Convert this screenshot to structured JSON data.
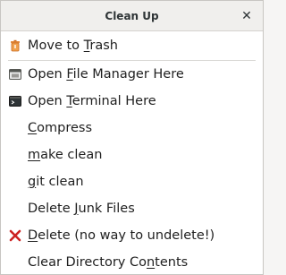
{
  "window": {
    "title": "Clean Up",
    "close_glyph": "✕"
  },
  "menu": {
    "items": [
      {
        "pre": "Move to ",
        "mn": "T",
        "post": "rash",
        "icon": "trash-icon"
      },
      {
        "pre": "Open ",
        "mn": "F",
        "post": "ile Manager Here",
        "icon": "file-manager-icon"
      },
      {
        "pre": "Open ",
        "mn": "T",
        "post": "erminal Here",
        "icon": "terminal-icon"
      },
      {
        "pre": "",
        "mn": "C",
        "post": "ompress"
      },
      {
        "pre": "",
        "mn": "m",
        "post": "ake clean"
      },
      {
        "pre": "",
        "mn": "g",
        "post": "it clean"
      },
      {
        "pre": "Delete ",
        "mn": "J",
        "post": "unk Files"
      },
      {
        "pre": "",
        "mn": "D",
        "post": "elete (no way to undelete!)",
        "icon": "delete-icon"
      },
      {
        "pre": "Clear Directory Co",
        "mn": "n",
        "post": "tents"
      }
    ]
  },
  "colors": {
    "delete_icon": "#cc2222",
    "trash_icon": "#e2883a"
  }
}
